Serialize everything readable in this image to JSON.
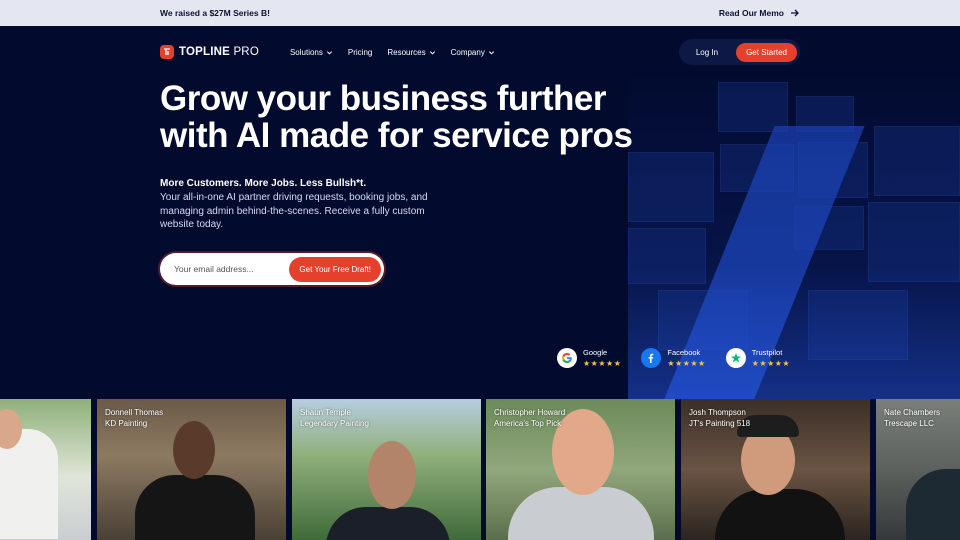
{
  "announcement": {
    "text": "We raised a $27M Series B!",
    "link": "Read Our Memo"
  },
  "nav": {
    "logo_main": "TOPLINE",
    "logo_sub": "PRO",
    "items": [
      {
        "label": "Solutions",
        "dropdown": true
      },
      {
        "label": "Pricing",
        "dropdown": false
      },
      {
        "label": "Resources",
        "dropdown": true
      },
      {
        "label": "Company",
        "dropdown": true
      }
    ],
    "login": "Log In",
    "get_started": "Get Started"
  },
  "hero": {
    "headline_line1": "Grow your business further",
    "headline_line2": "with AI made for service pros",
    "tagline": "More Customers. More Jobs. Less Bullsh*t.",
    "description": "Your all-in-one AI partner driving requests, booking jobs, and managing admin behind-the-scenes. Receive a fully custom website today.",
    "email_placeholder": "Your email address...",
    "cta": "Get Your Free Draft!"
  },
  "reviews": [
    {
      "name": "Google",
      "stars": "★★★★★",
      "icon": "google-icon"
    },
    {
      "name": "Facebook",
      "stars": "★★★★★",
      "icon": "facebook-icon"
    },
    {
      "name": "Trustpilot",
      "stars": "★★★★★",
      "icon": "trustpilot-icon"
    }
  ],
  "testimonials": [
    {
      "name": "",
      "company": ""
    },
    {
      "name": "Donnell Thomas",
      "company": "KD Painting"
    },
    {
      "name": "Shaun Temple",
      "company": "Legendary Painting"
    },
    {
      "name": "Christopher Howard",
      "company": "America's Top Pick"
    },
    {
      "name": "Josh Thompson",
      "company": "JT's Painting 518"
    },
    {
      "name": "Nate Chambers",
      "company": "Trescape LLC"
    }
  ],
  "colors": {
    "brand_red": "#e5402c",
    "navy": "#020a2e",
    "announce_bg": "#e4e7f2"
  }
}
